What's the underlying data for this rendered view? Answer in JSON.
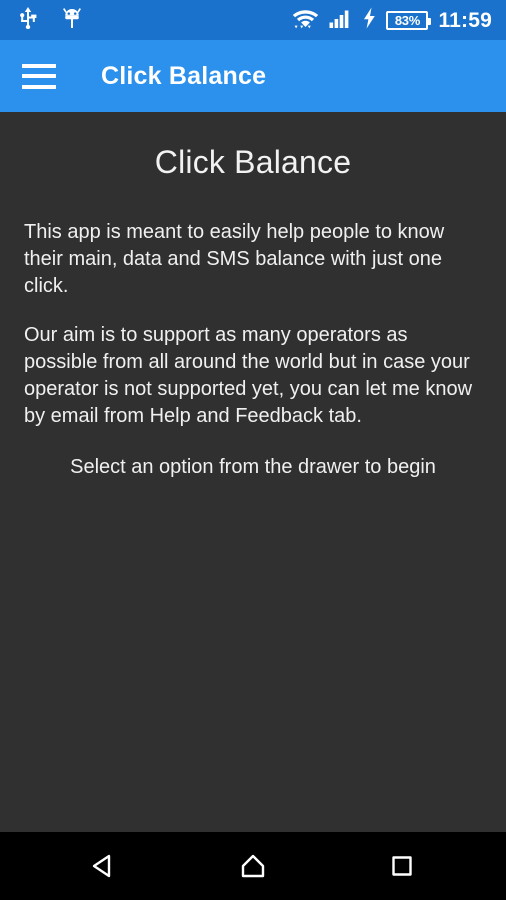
{
  "status_bar": {
    "left_icons": [
      {
        "name": "usb-icon",
        "label": "USB connected"
      },
      {
        "name": "android-debug-icon",
        "label": "USB debugging"
      }
    ],
    "right_icons": [
      {
        "name": "wifi-icon",
        "label": "Wi-Fi"
      },
      {
        "name": "cellular-signal-icon",
        "label": "Cellular signal"
      },
      {
        "name": "charging-bolt-icon",
        "label": "Charging"
      }
    ],
    "battery_percent": "83%",
    "time": "11:59",
    "background_color": "#1B72CC",
    "foreground_color": "#FFFFFF"
  },
  "app_bar": {
    "menu_icon": "hamburger-menu-icon",
    "title": "Click Balance",
    "background_color": "#2B91EC",
    "text_color": "#FFFFFF"
  },
  "content": {
    "heading": "Click Balance",
    "paragraphs": [
      "This app is meant to easily help people to know their main, data and SMS balance with just one click.",
      "Our aim is to support as many operators as possible from all around the world but in case your operator is not supported yet, you can let me know by email from Help and Feedback tab."
    ],
    "hint": "Select an option from the drawer to begin",
    "background_color": "#303030",
    "text_color": "#F0F0F0"
  },
  "nav_bar": {
    "buttons": [
      {
        "name": "back-button",
        "label": "Back"
      },
      {
        "name": "home-button",
        "label": "Home"
      },
      {
        "name": "recents-button",
        "label": "Recent apps"
      }
    ],
    "background_color": "#000000",
    "icon_color": "#FFFFFF"
  }
}
